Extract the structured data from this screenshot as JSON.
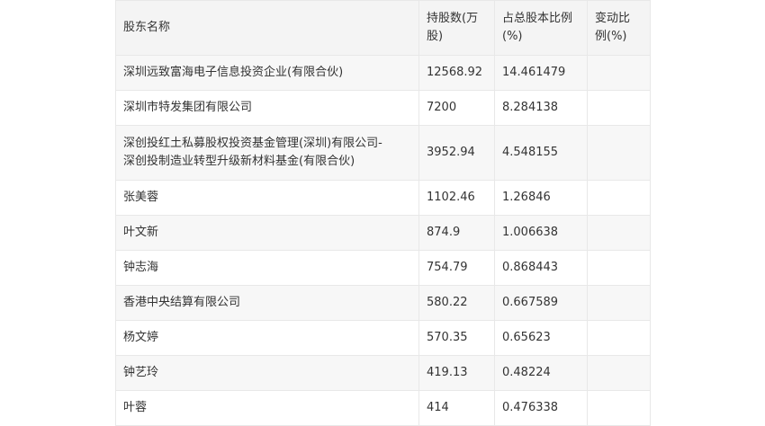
{
  "table": {
    "headers": {
      "name": "股东名称",
      "shares_line1": "持股数(万",
      "shares_line2": "股)",
      "pct_line1": "占总股本比例",
      "pct_line2": "(%)",
      "change_line1": "变动比",
      "change_line2": "例(%)"
    },
    "rows": [
      {
        "name": "深圳远致富海电子信息投资企业(有限合伙)",
        "shares": "12568.92",
        "pct": "14.461479",
        "change": ""
      },
      {
        "name": "深圳市特发集团有限公司",
        "shares": "7200",
        "pct": "8.284138",
        "change": ""
      },
      {
        "name": "深创投红土私募股权投资基金管理(深圳)有限公司-",
        "name_line2": "深创投制造业转型升级新材料基金(有限合伙)",
        "shares": "3952.94",
        "pct": "4.548155",
        "change": ""
      },
      {
        "name": "张美蓉",
        "shares": "1102.46",
        "pct": "1.26846",
        "change": ""
      },
      {
        "name": "叶文新",
        "shares": "874.9",
        "pct": "1.006638",
        "change": ""
      },
      {
        "name": "钟志海",
        "shares": "754.79",
        "pct": "0.868443",
        "change": ""
      },
      {
        "name": "香港中央结算有限公司",
        "shares": "580.22",
        "pct": "0.667589",
        "change": ""
      },
      {
        "name": "杨文婷",
        "shares": "570.35",
        "pct": "0.65623",
        "change": ""
      },
      {
        "name": "钟艺玲",
        "shares": "419.13",
        "pct": "0.48224",
        "change": ""
      },
      {
        "name": "叶蓉",
        "shares": "414",
        "pct": "0.476338",
        "change": ""
      }
    ]
  }
}
